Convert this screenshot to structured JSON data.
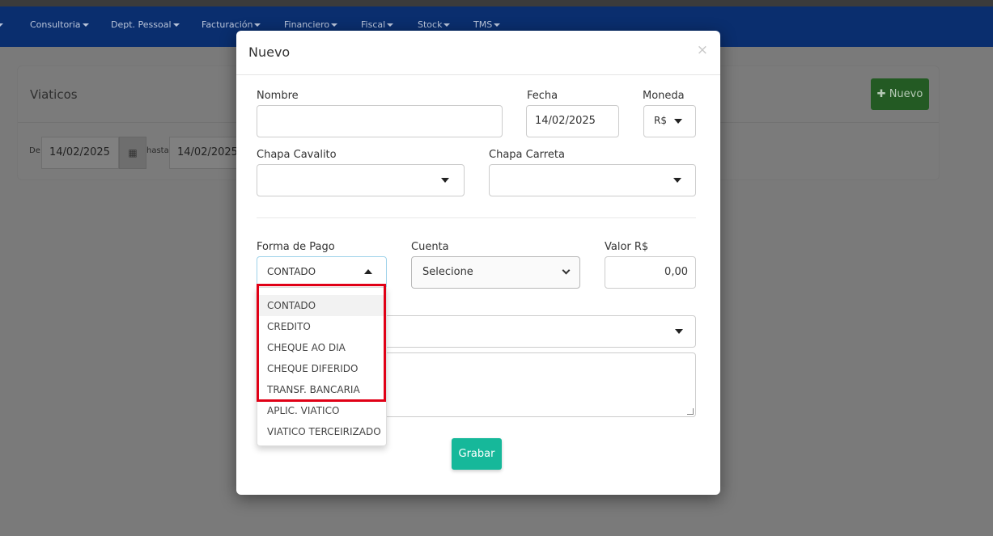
{
  "nav": {
    "items": [
      {
        "label": "Consultoria"
      },
      {
        "label": "Dept. Pessoal"
      },
      {
        "label": "Facturación"
      },
      {
        "label": "Financiero"
      },
      {
        "label": "Fiscal"
      },
      {
        "label": "Stock"
      },
      {
        "label": "TMS"
      }
    ]
  },
  "background": {
    "title": "Viaticos",
    "new_button": "Nuevo",
    "filter_from_label": "De",
    "filter_from_value": "14/02/2025",
    "filter_to_label": "hasta",
    "filter_to_value": "14/02/2025"
  },
  "modal": {
    "title": "Nuevo",
    "close": "×",
    "nombre_label": "Nombre",
    "nombre_value": "",
    "fecha_label": "Fecha",
    "fecha_value": "14/02/2025",
    "moneda_label": "Moneda",
    "moneda_value": "R$",
    "chapa_cavalito_label": "Chapa Cavalito",
    "chapa_carreta_label": "Chapa Carreta",
    "forma_pago_label": "Forma de Pago",
    "forma_pago_value": "CONTADO",
    "cuenta_label": "Cuenta",
    "cuenta_value": "Selecione",
    "valor_label": "Valor R$",
    "valor_value": "0,00",
    "grabar": "Grabar",
    "forma_pago_options": [
      "CONTADO",
      "CREDITO",
      "CHEQUE AO DIA",
      "CHEQUE DIFERIDO",
      "TRANSF. BANCARIA",
      "APLIC. VIATICO",
      "VIATICO TERCEIRIZADO"
    ]
  },
  "colors": {
    "navbar": "#0a2e6e",
    "accent_button": "#16b89a",
    "highlight": "#e00016"
  }
}
